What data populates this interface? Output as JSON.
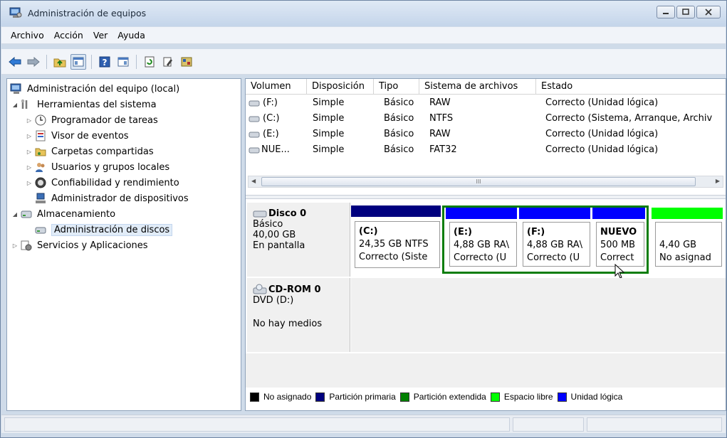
{
  "window": {
    "title": "Administración de equipos",
    "icon": "computer-management-icon"
  },
  "menu": [
    "Archivo",
    "Acción",
    "Ver",
    "Ayuda"
  ],
  "toolbar": {
    "icons": [
      "back-icon",
      "forward-icon",
      "up-folder-icon",
      "show-hide-tree-icon",
      "help-icon",
      "show-hide-action-pane-icon",
      "refresh-icon",
      "properties-icon",
      "help-topics-icon"
    ]
  },
  "tree": {
    "root": "Administración del equipo (local)",
    "system_tools": "Herramientas del sistema",
    "task_scheduler": "Programador de tareas",
    "event_viewer": "Visor de eventos",
    "shared_folders": "Carpetas compartidas",
    "local_users": "Usuarios y grupos locales",
    "reliability": "Confiabilidad y rendimiento",
    "device_manager": "Administrador de dispositivos",
    "storage": "Almacenamiento",
    "disk_management": "Administración de discos",
    "services": "Servicios y Aplicaciones"
  },
  "volumes": {
    "columns": [
      "Volumen",
      "Disposición",
      "Tipo",
      "Sistema de archivos",
      "Estado"
    ],
    "rows": [
      {
        "volumen": "(F:)",
        "disposicion": "Simple",
        "tipo": "Básico",
        "fs": "RAW",
        "estado": "Correcto (Unidad lógica)"
      },
      {
        "volumen": "(C:)",
        "disposicion": "Simple",
        "tipo": "Básico",
        "fs": "NTFS",
        "estado": "Correcto (Sistema, Arranque, Archiv"
      },
      {
        "volumen": "(E:)",
        "disposicion": "Simple",
        "tipo": "Básico",
        "fs": "RAW",
        "estado": "Correcto (Unidad lógica)"
      },
      {
        "volumen": "NUE...",
        "disposicion": "Simple",
        "tipo": "Básico",
        "fs": "FAT32",
        "estado": "Correcto (Unidad lógica)"
      }
    ],
    "scroll_thumb": "III"
  },
  "disk0": {
    "name": "Disco 0",
    "type": "Básico",
    "size": "40,00 GB",
    "status": "En pantalla",
    "partitions": [
      {
        "name": "(C:)",
        "size": "24,35 GB NTFS",
        "status": "Correcto (Siste",
        "color": "#00007f"
      },
      {
        "name": "(E:)",
        "size": "4,88 GB RA\\",
        "status": "Correcto (U",
        "color": "#0000ff"
      },
      {
        "name": "(F:)",
        "size": "4,88 GB RA\\",
        "status": "Correcto (U",
        "color": "#0000ff"
      },
      {
        "name": "NUEVO",
        "size": "500 MB",
        "status": "Correct",
        "color": "#0000ff"
      },
      {
        "name": "",
        "size": "4,40 GB",
        "status": "No asignad",
        "color": "#00ff00"
      }
    ]
  },
  "cdrom": {
    "name": "CD-ROM 0",
    "drive": "DVD (D:)",
    "status": "No hay medios"
  },
  "legend": [
    {
      "label": "No asignado",
      "color": "#000000"
    },
    {
      "label": "Partición primaria",
      "color": "#00007f"
    },
    {
      "label": "Partición extendida",
      "color": "#008000"
    },
    {
      "label": "Espacio libre",
      "color": "#00ff00"
    },
    {
      "label": "Unidad lógica",
      "color": "#0000ff"
    }
  ]
}
